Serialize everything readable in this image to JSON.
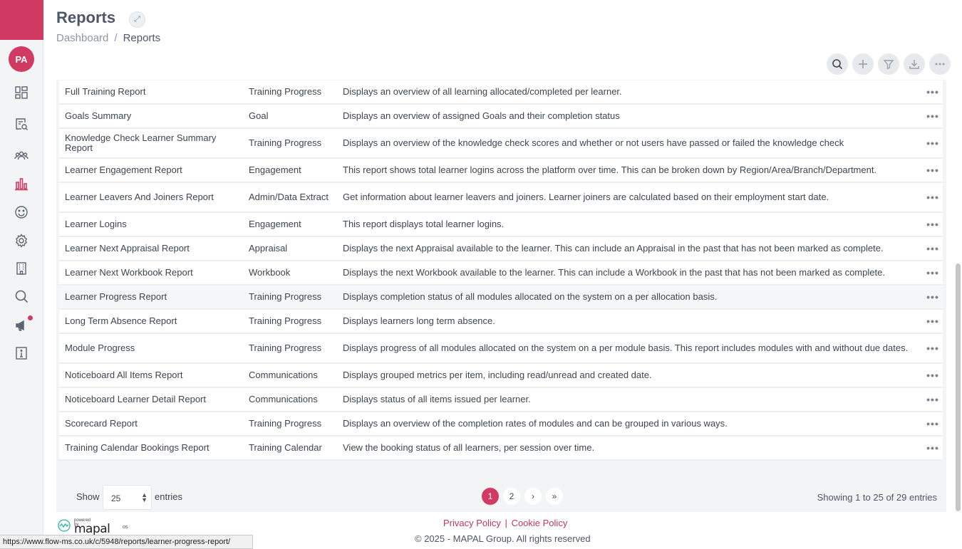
{
  "sidebar": {
    "avatar_initials": "PA",
    "icons": [
      "dashboard-icon",
      "report-search-icon",
      "people-icon",
      "reports-chart-icon",
      "smile-icon",
      "gear-icon",
      "building-icon",
      "search-icon",
      "megaphone-icon",
      "info-icon"
    ],
    "accent": "#d03a63"
  },
  "header": {
    "title": "Reports",
    "breadcrumb": {
      "home": "Dashboard",
      "separator": "/",
      "current": "Reports"
    }
  },
  "toolbar": [
    "search-icon",
    "plus-icon",
    "filter-icon",
    "download-icon",
    "more-icon"
  ],
  "table": {
    "rows": [
      {
        "name": "Full Training Report",
        "category": "Training Progress",
        "description": "Displays an overview of all learning allocated/completed per learner."
      },
      {
        "name": "Goals Summary",
        "category": "Goal",
        "description": "Displays an overview of assigned Goals and their completion status"
      },
      {
        "name": "Knowledge Check Learner Summary Report",
        "category": "Training Progress",
        "description": "Displays an overview of the knowledge check scores and whether or not users have passed or failed the knowledge check"
      },
      {
        "name": "Learner Engagement Report",
        "category": "Engagement",
        "description": "This report shows total learner logins across the platform over time. This can be broken down by Region/Area/Branch/Department."
      },
      {
        "name": "Learner Leavers And Joiners Report",
        "category": "Admin/Data Extract",
        "description": "Get information about learner leavers and joiners. Learner joiners are calculated based on their employment start date."
      },
      {
        "name": "Learner Logins",
        "category": "Engagement",
        "description": "This report displays total learner logins."
      },
      {
        "name": "Learner Next Appraisal Report",
        "category": "Appraisal",
        "description": "Displays the next Appraisal available to the learner. This can include an Appraisal in the past that has not been marked as complete."
      },
      {
        "name": "Learner Next Workbook Report",
        "category": "Workbook",
        "description": "Displays the next Workbook available to the learner. This can include a Workbook in the past that has not been marked as complete."
      },
      {
        "name": "Learner Progress Report",
        "category": "Training Progress",
        "description": "Displays completion status of all modules allocated on the system on a per allocation basis."
      },
      {
        "name": "Long Term Absence Report",
        "category": "Training Progress",
        "description": "Displays learners long term absence."
      },
      {
        "name": "Module Progress",
        "category": "Training Progress",
        "description": "Displays progress of all modules allocated on the system on a per module basis. This report includes modules with and without due dates."
      },
      {
        "name": "Noticeboard All Items Report",
        "category": "Communications",
        "description": "Displays grouped metrics per item, including read/unread and created date."
      },
      {
        "name": "Noticeboard Learner Detail Report",
        "category": "Communications",
        "description": "Displays status of all items issued per learner."
      },
      {
        "name": "Scorecard Report",
        "category": "Training Progress",
        "description": "Displays an overview of the completion rates of modules and can be grouped in various ways."
      },
      {
        "name": "Training Calendar Bookings Report",
        "category": "Training Calendar",
        "description": "View the booking status of all learners, per session over time."
      }
    ],
    "row_menu": "•••"
  },
  "pagination": {
    "show_label": "Show",
    "page_size": "25",
    "entries_label": "entries",
    "pages": [
      "1",
      "2"
    ],
    "next": "›",
    "last": "»",
    "summary": "Showing 1 to 25 of 29 entries"
  },
  "footer": {
    "privacy": "Privacy Policy",
    "separator": "|",
    "cookie": "Cookie Policy",
    "copyright": "© 2025 - MAPAL Group. All rights reserved",
    "powered_by": "powered by",
    "logo": "mapal",
    "logo_suffix": "os"
  },
  "status_url": "https://www.flow-ms.co.uk/c/5948/reports/learner-progress-report/"
}
